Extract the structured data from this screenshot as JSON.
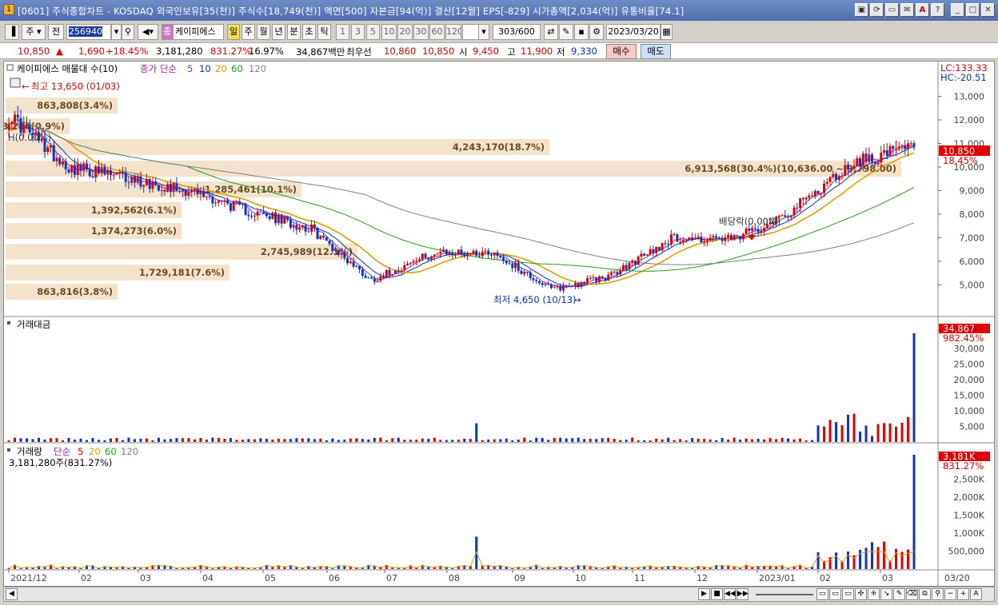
{
  "window": {
    "title": "[0601] 주식종합차트 - KOSDAQ 외국인보유[35(천)] 주식수[18,749(천)] 액면[500] 자본금[94(억)] 결산[12월] EPS[-829] 시가총액[2,034(억)] 유통비율[74.1]",
    "app_icon": "1",
    "buttons": [
      "▣",
      "⟳",
      "▭",
      "✉",
      "A",
      "?",
      "_",
      "□",
      "✕"
    ]
  },
  "toolbar": {
    "period_mode": "주",
    "jeon": "전",
    "stock_code": "256940",
    "stock_name": "케이피에스",
    "tags": [
      "종",
      "일",
      "주",
      "월",
      "년",
      "분",
      "초",
      "틱"
    ],
    "intervals": [
      "1",
      "3",
      "5",
      "10",
      "20",
      "30",
      "60",
      "120"
    ],
    "count": "303",
    "count_total": "/600",
    "date": "2023/03/20"
  },
  "quote": {
    "price": "10,850",
    "arrow": "▲",
    "change": "1,690",
    "change_pct": "+18.45%",
    "volume": "3,181,280",
    "volume_ratio": "831.27%",
    "turnover": "16.97%",
    "amount": "34,867백만",
    "priority_label": "최우선",
    "bid": "10,860",
    "ask": "10,850",
    "open_label": "시",
    "open": "9,450",
    "high_label": "고",
    "high": "11,900",
    "low_label": "저",
    "low": "9,330",
    "buy": "매수",
    "sell": "매도"
  },
  "price_panel": {
    "title": "케이피에스 매물대 수(10)",
    "ma_label": "종가 단순",
    "ma_periods": [
      "5",
      "10",
      "20",
      "60",
      "120"
    ],
    "ma_colors": [
      "#7040c0",
      "#1030b0",
      "#e0a000",
      "#20a020",
      "#808080"
    ],
    "lc_label": "LC:133.33",
    "hc_label": "HC:-20.51",
    "high_marker": "최고 13,650 (01/03)",
    "low_marker": "최저 4,650 (10/13)",
    "dividend_marker": "배당락(0.00%)",
    "zero_marker": "H(0.00%)",
    "current_price_tag": "10,850",
    "current_pct_tag": "18.45%",
    "y_ticks": [
      "13,000",
      "12,000",
      "11,000",
      "10,000",
      "9,000",
      "8,000",
      "7,000",
      "6,000",
      "5,000"
    ],
    "volume_profile": [
      {
        "label": "863,808(3.4%)"
      },
      {
        "label": "23,284(0.9%)"
      },
      {
        "label": "4,243,170(18.7%)"
      },
      {
        "label": "6,913,568(30.4%)(10,636.00 ~ 9,798.00)"
      },
      {
        "label": "1,285,461(10.1%)"
      },
      {
        "label": "1,392,562(6.1%)"
      },
      {
        "label": "1,374,273(6.0%)"
      },
      {
        "label": "2,745,989(12.1%)"
      },
      {
        "label": "1,729,181(7.6%)"
      },
      {
        "label": "863,816(3.8%)"
      }
    ]
  },
  "amount_panel": {
    "title": "거래대금",
    "value_tag": "34,867",
    "pct_tag": "982.45%",
    "y_ticks": [
      "30,000",
      "25,000",
      "20,000",
      "15,000",
      "10,000",
      "5,000"
    ]
  },
  "volume_panel": {
    "title": "거래량",
    "ma_label": "단순",
    "ma_periods": [
      "5",
      "20",
      "60",
      "120"
    ],
    "current_label": "3,181,280주(831.27%)",
    "value_tag": "3,181K",
    "pct_tag": "831.27%",
    "y_ticks": [
      "2,500K",
      "2,000K",
      "1,500K",
      "1,000K",
      "500,000"
    ]
  },
  "x_axis": [
    "2021/12",
    "02",
    "03",
    "04",
    "05",
    "06",
    "07",
    "08",
    "09",
    "10",
    "11",
    "12",
    "2023/01",
    "02",
    "03",
    "03/20"
  ],
  "chart_data": {
    "type": "line",
    "title": "케이피에스 매물대 수(10)",
    "x": [
      "2021/12",
      "02",
      "03",
      "04",
      "05",
      "06",
      "07",
      "08",
      "09",
      "10",
      "11",
      "12",
      "2023/01",
      "02",
      "03",
      "03/20"
    ],
    "series": [
      {
        "name": "종가",
        "values": [
          12200,
          10000,
          9500,
          9000,
          8100,
          7400,
          5200,
          6300,
          6400,
          4800,
          5400,
          7000,
          6900,
          8200,
          10200,
          10850
        ]
      }
    ],
    "ylim": [
      4300,
      13800
    ],
    "annotations": [
      "최고 13,650 (01/03)",
      "최저 4,650 (10/13)",
      "배당락(0.00%)"
    ]
  }
}
